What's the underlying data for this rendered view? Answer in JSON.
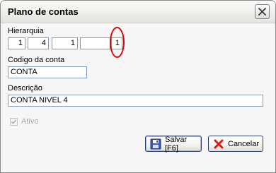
{
  "window": {
    "title": "Plano de contas",
    "close_icon": "close-x-icon"
  },
  "hierarquia": {
    "label": "Hierarquia",
    "fields": [
      "1",
      "4",
      "1",
      "",
      "1"
    ]
  },
  "codigo": {
    "label": "Codigo da conta",
    "value": "CONTA"
  },
  "descricao": {
    "label": "Descrição",
    "value": "CONTA NIVEL 4"
  },
  "ativo": {
    "label": "Ativo",
    "checked": true,
    "disabled": true
  },
  "buttons": {
    "save_label": "Salvar [F6]",
    "save_icon": "floppy-disk-icon",
    "cancel_label": "Cancelar",
    "cancel_icon": "red-x-icon"
  },
  "colors": {
    "highlight": "#e00000",
    "field_border": "#7f9db9"
  }
}
